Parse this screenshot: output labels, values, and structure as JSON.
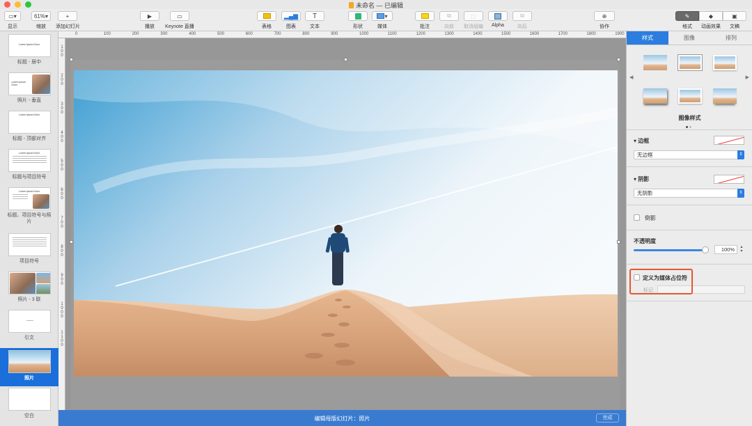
{
  "window": {
    "title": "未命名 — 已编辑"
  },
  "toolbar": {
    "view_label": "显示",
    "zoom_value": "61%",
    "zoom_label": "缩放",
    "add_slide_label": "添加幻灯片",
    "play_label": "播放",
    "keynote_live_label": "Keynote 直播",
    "table_label": "表格",
    "chart_label": "图表",
    "text_label": "文本",
    "shape_label": "形状",
    "media_label": "媒体",
    "comment_label": "批注",
    "forward_label": "向前",
    "ungroup_label": "取消组编",
    "alpha_label": "Alpha",
    "backward_label": "向后",
    "collaborate_label": "协作",
    "format_label": "格式",
    "animate_label": "动画效果",
    "document_label": "文稿"
  },
  "navigator": {
    "slides": [
      {
        "label": "标题 - 居中",
        "preview_text": "Lorem Ipsum Dolor"
      },
      {
        "label": "照片 - 垂直",
        "preview_text": "Lorem Ipsum Dolor"
      },
      {
        "label": "标题 - 顶部对齐",
        "preview_text": "Lorem Ipsum Dolor"
      },
      {
        "label": "标题与项目符号",
        "preview_text": "Lorem Ipsum Dolor"
      },
      {
        "label": "标题、项目符号与照片",
        "preview_text": "Lorem Ipsum Dolor"
      },
      {
        "label": "项目符号",
        "preview_text": ""
      },
      {
        "label": "照片 - 3 联",
        "preview_text": ""
      },
      {
        "label": "引文",
        "preview_text": ""
      },
      {
        "label": "照片",
        "preview_text": ""
      },
      {
        "label": "空白",
        "preview_text": ""
      }
    ],
    "selected_index": 8
  },
  "ruler": {
    "h_ticks": [
      "0",
      "100",
      "200",
      "300",
      "400",
      "500",
      "600",
      "700",
      "800",
      "900",
      "1000",
      "1100",
      "1200",
      "1300",
      "1400",
      "1500",
      "1600",
      "1700",
      "1800",
      "1900"
    ],
    "v_ticks": [
      "100",
      "200",
      "300",
      "400",
      "500",
      "600",
      "700",
      "800",
      "900",
      "1000",
      "1100"
    ]
  },
  "bottom_bar": {
    "editing_label": "编辑母版幻灯片：照片",
    "done_label": "完成"
  },
  "inspector": {
    "tabs": [
      "样式",
      "图像",
      "排列"
    ],
    "active_tab": 0,
    "image_styles_label": "图像样式",
    "border": {
      "title": "边框",
      "value": "无边框"
    },
    "shadow": {
      "title": "阴影",
      "value": "无阴影"
    },
    "reflection_label": "倒影",
    "opacity": {
      "title": "不透明度",
      "value": "100%",
      "level": 1.0
    },
    "placeholder": {
      "label": "定义为媒体占位符",
      "tag_label": "标记"
    }
  },
  "colors": {
    "accent": "#2b7de0",
    "bottom_bar": "#3a7bd0",
    "highlight": "#e4572e"
  }
}
